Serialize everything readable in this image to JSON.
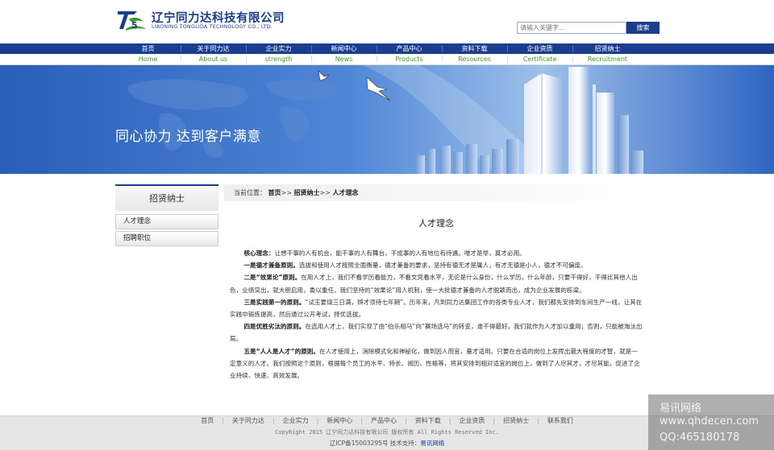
{
  "header": {
    "company_cn": "辽宁同力达科技有限公司",
    "company_en": "LIAONING TONGLIDA TECHNOLOGY CO., LTD."
  },
  "search": {
    "placeholder": "请输入关键字...",
    "button_label": "搜索"
  },
  "nav": {
    "items": [
      {
        "cn": "首页",
        "en": "Home"
      },
      {
        "cn": "关于同力达",
        "en": "About us"
      },
      {
        "cn": "企业实力",
        "en": "strength"
      },
      {
        "cn": "新闻中心",
        "en": "News"
      },
      {
        "cn": "产品中心",
        "en": "Products"
      },
      {
        "cn": "资料下载",
        "en": "Resources"
      },
      {
        "cn": "企业资质",
        "en": "Certificate"
      },
      {
        "cn": "招贤纳士",
        "en": "Recruitment"
      }
    ]
  },
  "banner": {
    "slogan": "同心协力 达到客户满意"
  },
  "sidebar": {
    "title": "招贤纳士",
    "items": [
      "人才理念",
      "招聘职位"
    ]
  },
  "breadcrumb": {
    "prefix": "当前位置：",
    "home": "首页",
    "sep1": ">>",
    "section": "招贤纳士",
    "sep2": ">>",
    "current": "人才理念"
  },
  "article": {
    "title": "人才理念",
    "p1_lead": "核心理念：",
    "p1_text": "让想干事的人有机会，能干事的人有舞台，干成事的人有地位有待遇。唯才是举，真才必用。",
    "p2_lead": "一是德才兼备原则。",
    "p2_text": "选拔和使用人才按照全面衡量，德才兼备的要求，坚持有德无才是庸人，有才无德是小人，德才不可偏废。",
    "p3_lead": "二是“效果论”原则。",
    "p3_text": "在用人才上，我们不看学历看能力，不看文凭看水平，无论是什么身份，什么学历，什么年龄，只要干得好，干得比其他人出色，业绩突出，就大胆启用，委以重任。我们坚持的“效果论”用人机制，使一大批德才兼备的人才脱颖而出，成为企业发展的栋梁。",
    "p4_lead": "三是实践第一的原则。",
    "p4_text": "“试玉要烧三日满，辨才须待七年期”。历年来，凡到同力达集团工作的各类专业人才，我们都先安排到车间生产一线，让其在实践中锻炼提高，然后通过公开考试，择优选拔。",
    "p5_lead": "四是优胜劣汰的原则。",
    "p5_text": "在选用人才上，我们实现了由“伯乐相马”向“赛场选马”的转变，谁干得最好，我们就作为人才加以重用；否则，只能被淘汰出局。",
    "p6_lead": "五是“人人是人才”的原则。",
    "p6_text": "在人才使用上，消除模式化和神秘化，做到因人而宜，量才适用。只要在合适的岗位上发挥出最大程度的才智，就是一定意义的人才。我们按照这个原则，根据每个员工的水平、特长、阅历、性格等，将其安排到相对适宜的岗位上，做到了人尽其才，才尽其能，促进了企业持续、快速、高效发展。"
  },
  "footer": {
    "links": [
      "首页",
      "关于同力达",
      "企业实力",
      "新闻中心",
      "产品中心",
      "资料下载",
      "企业资质",
      "招贤纳士",
      "联系我们"
    ],
    "copyright": "CopyRight 2015 辽宁同力达科技有限公司  版权所有 All Rights Reserved Inc.",
    "icp": "辽ICP备15003295号",
    "support_label": "技术支持：",
    "support_link": "易讯网络"
  },
  "watermark": {
    "line1": "易讯网络",
    "line2": "www.qhdecen.com",
    "line3": "QQ:465180178"
  },
  "colors": {
    "brand_blue": "#1a3d8f",
    "nav_en_green": "#3a9a2c",
    "banner_blue": "#2f65c2"
  }
}
